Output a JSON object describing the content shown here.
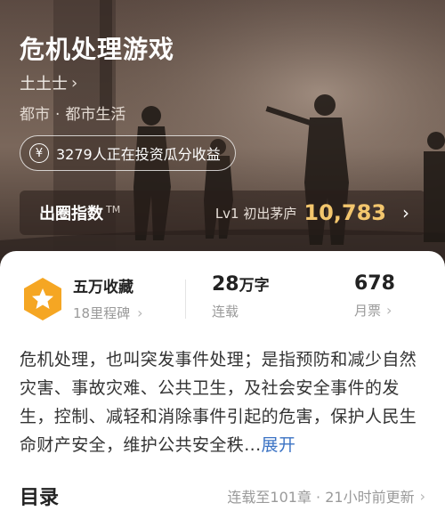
{
  "book": {
    "title": "危机处理游戏",
    "author": "土土士",
    "category": "都市",
    "subcategory": "都市生活"
  },
  "invest": {
    "text": "3279人正在投资瓜分收益",
    "icon": "yen-icon"
  },
  "index_bar": {
    "label": "出圈指数",
    "tm": "TM",
    "level": "Lv1 初出茅庐",
    "value": "10,783"
  },
  "stats": {
    "favorites": "五万收藏",
    "favorites_sub": "18里程碑",
    "words_num": "28",
    "words_unit": "万字",
    "words_caption": "连载",
    "tickets": "678",
    "tickets_caption": "月票"
  },
  "synopsis": {
    "text": "危机处理，也叫突发事件处理；是指预防和减少自然灾害、事故灾难、公共卫生，及社会安全事件的发生，控制、减轻和消除事件引起的危害，保护人民生命财产安全，维护公共安全秩...",
    "expand": "展开"
  },
  "toc": {
    "title": "目录",
    "status": "连载至101章 · 21小时前更新"
  },
  "colors": {
    "accent_gold": "#f3c66d",
    "link_blue": "#3b73c4",
    "badge_orange": "#f5a623"
  }
}
